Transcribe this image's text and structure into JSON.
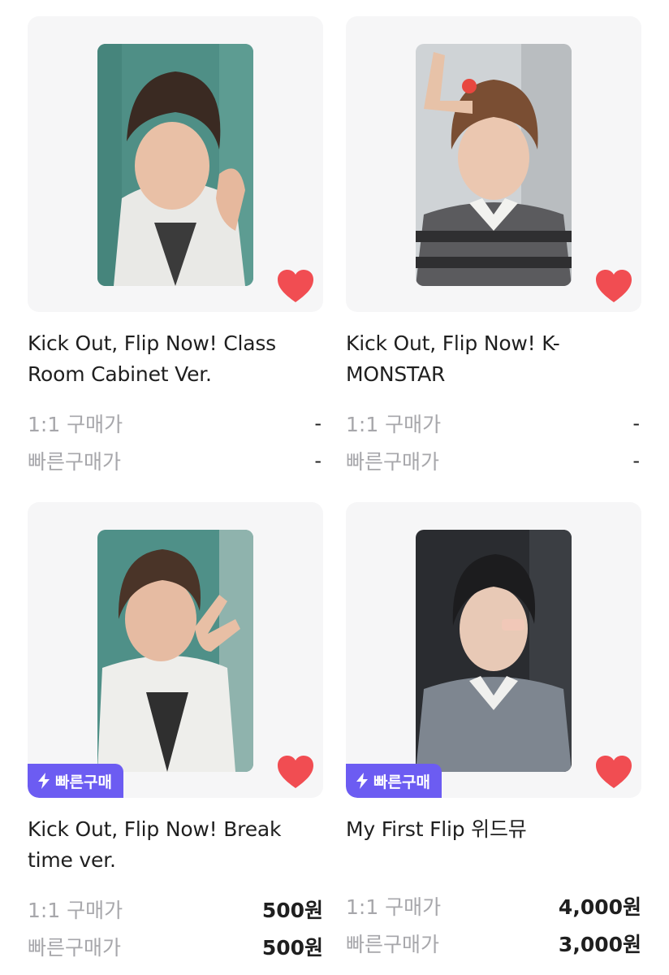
{
  "colors": {
    "heart": "#f14d52",
    "badge": "#6c5cf2",
    "card_bg": "#f6f6f7",
    "label_gray": "#a7a7ab"
  },
  "products": [
    {
      "title": "Kick Out, Flip Now! Class Room Cabinet Ver.",
      "image_icon": "photocard-image",
      "quick_badge": null,
      "liked": true,
      "one_to_one_label": "1:1 구매가",
      "one_to_one_price": "-",
      "quick_label": "빠른구매가",
      "quick_price": "-"
    },
    {
      "title": "Kick Out, Flip Now! K-MONSTAR",
      "image_icon": "photocard-image",
      "quick_badge": null,
      "liked": true,
      "one_to_one_label": "1:1 구매가",
      "one_to_one_price": "-",
      "quick_label": "빠른구매가",
      "quick_price": "-"
    },
    {
      "title": "Kick Out, Flip Now! Break time ver.",
      "image_icon": "photocard-image",
      "quick_badge": "빠른구매",
      "liked": true,
      "one_to_one_label": "1:1 구매가",
      "one_to_one_price": "500원",
      "quick_label": "빠른구매가",
      "quick_price": "500원"
    },
    {
      "title": "My First Flip 위드뮤",
      "image_icon": "photocard-image",
      "quick_badge": "빠른구매",
      "liked": true,
      "one_to_one_label": "1:1 구매가",
      "one_to_one_price": "4,000원",
      "quick_label": "빠른구매가",
      "quick_price": "3,000원"
    }
  ]
}
